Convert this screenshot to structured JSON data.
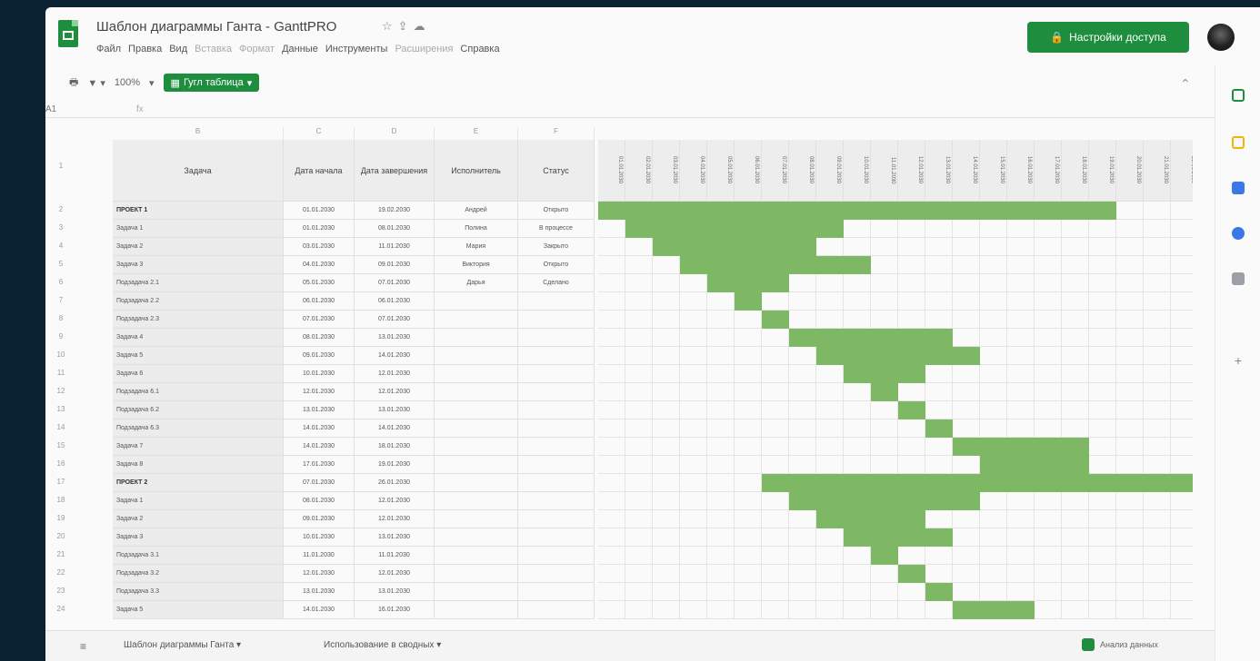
{
  "header": {
    "title": "Шаблон диаграммы Ганта - GanttPRO",
    "menu": [
      "Файл",
      "Правка",
      "Вид",
      "Вставка",
      "Формат",
      "Данные",
      "Инструменты",
      "Расширения",
      "Справка"
    ],
    "extension_button": "Настройки доступа"
  },
  "toolbar": {
    "zoom": "100%",
    "green_button": "Гугл таблица"
  },
  "formula_bar": {
    "cell_ref": "A1",
    "fx": "fx"
  },
  "columns": {
    "b": "B",
    "c": "C",
    "d": "D",
    "e": "E",
    "f": "F"
  },
  "table_headers": {
    "task": "Задача",
    "start": "Дата начала",
    "end": "Дата завершения",
    "assignee": "Исполнитель",
    "status": "Статус"
  },
  "rows": [
    {
      "task": "ПРОЕКТ 1",
      "start": "01.01.2030",
      "end": "19.02.2030",
      "assignee": "Андрей",
      "status": "Открыто",
      "bold": true
    },
    {
      "task": "Задача 1",
      "start": "01.01.2030",
      "end": "08.01.2030",
      "assignee": "Полина",
      "status": "В процессе"
    },
    {
      "task": "Задача 2",
      "start": "03.01.2030",
      "end": "11.01.2030",
      "assignee": "Мария",
      "status": "Закрыто"
    },
    {
      "task": "Задача 3",
      "start": "04.01.2030",
      "end": "09.01.2030",
      "assignee": "Виктория",
      "status": "Открыто"
    },
    {
      "task": "Подзадача 2.1",
      "start": "05.01.2030",
      "end": "07.01.2030",
      "assignee": "Дарья",
      "status": "Сделано"
    },
    {
      "task": "Подзадача 2.2",
      "start": "06.01.2030",
      "end": "06.01.2030"
    },
    {
      "task": "Подзадача 2.3",
      "start": "07.01.2030",
      "end": "07.01.2030"
    },
    {
      "task": "Задача 4",
      "start": "08.01.2030",
      "end": "13.01.2030"
    },
    {
      "task": "Задача 5",
      "start": "09.01.2030",
      "end": "14.01.2030"
    },
    {
      "task": "Задача 6",
      "start": "10.01.2030",
      "end": "12.01.2030"
    },
    {
      "task": "Подзадача 6.1",
      "start": "12.01.2030",
      "end": "12.01.2030"
    },
    {
      "task": "Подзадача 6.2",
      "start": "13.01.2030",
      "end": "13.01.2030"
    },
    {
      "task": "Подзадача 6.3",
      "start": "14.01.2030",
      "end": "14.01.2030"
    },
    {
      "task": "Задача 7",
      "start": "14.01.2030",
      "end": "18.01.2030"
    },
    {
      "task": "Задача 8",
      "start": "17.01.2030",
      "end": "19.01.2030"
    },
    {
      "task": "ПРОЕКТ 2",
      "start": "07.01.2030",
      "end": "26.01.2030",
      "bold": true
    },
    {
      "task": "Задача 1",
      "start": "08.01.2030",
      "end": "12.01.2030"
    },
    {
      "task": "Задача 2",
      "start": "09.01.2030",
      "end": "12.01.2030"
    },
    {
      "task": "Задача 3",
      "start": "10.01.2030",
      "end": "13.01.2030"
    },
    {
      "task": "Подзадача 3.1",
      "start": "11.01.2030",
      "end": "11.01.2030"
    },
    {
      "task": "Подзадача 3.2",
      "start": "12.01.2030",
      "end": "12.01.2030"
    },
    {
      "task": "Подзадача 3.3",
      "start": "13.01.2030",
      "end": "13.01.2030"
    },
    {
      "task": "Задача 5",
      "start": "14.01.2030",
      "end": "16.01.2030"
    }
  ],
  "gantt": {
    "bar_color": "#7fb864",
    "days": [
      "01.01.2030",
      "02.01.2030",
      "03.01.2030",
      "04.01.2030",
      "05.01.2030",
      "06.01.2030",
      "07.01.2030",
      "08.01.2030",
      "09.01.2030",
      "10.01.2030",
      "11.01.2030",
      "12.01.2030",
      "13.01.2030",
      "14.01.2030",
      "15.01.2030",
      "16.01.2030",
      "17.01.2030",
      "18.01.2030",
      "19.01.2030",
      "20.01.2030",
      "21.01.2030",
      "22.01.2030",
      "23.01.2030"
    ],
    "bars": [
      [
        0,
        18
      ],
      [
        1,
        8
      ],
      [
        2,
        7
      ],
      [
        3,
        9
      ],
      [
        4,
        6
      ],
      [
        5,
        5
      ],
      [
        6,
        6
      ],
      [
        7,
        12
      ],
      [
        8,
        13
      ],
      [
        9,
        11
      ],
      [
        10,
        10
      ],
      [
        11,
        11
      ],
      [
        12,
        12
      ],
      [
        13,
        17
      ],
      [
        14,
        17
      ],
      [
        6,
        21
      ],
      [
        7,
        13
      ],
      [
        8,
        11
      ],
      [
        9,
        12
      ],
      [
        10,
        10
      ],
      [
        11,
        11
      ],
      [
        12,
        12
      ],
      [
        13,
        15
      ]
    ]
  },
  "bottom": {
    "tabs": [
      "Шаблон диаграммы Ганта ▾",
      "Использование в сводных ▾"
    ],
    "explore": "Анализ данных"
  }
}
